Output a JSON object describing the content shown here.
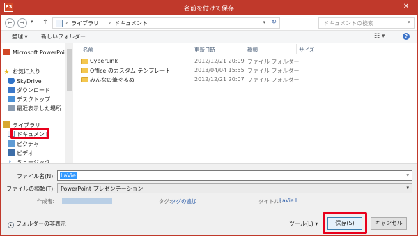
{
  "window": {
    "title": "名前を付けて保存",
    "app_icon_text": "P3",
    "close_glyph": "✕"
  },
  "nav": {
    "back_glyph": "←",
    "forward_glyph": "→",
    "up_glyph": "↑",
    "breadcrumb": [
      "ライブラリ",
      "ドキュメント"
    ],
    "search_placeholder": "ドキュメントの検索"
  },
  "toolbar": {
    "organize_label": "整理 ▾",
    "new_folder_label": "新しいフォルダー",
    "view_glyph": "☷ ▾",
    "help_glyph": "?"
  },
  "nav_pane": {
    "items": [
      {
        "label": "Microsoft PowerPoi",
        "icon": "powerpoint-icon",
        "color": "#d24726"
      },
      {
        "label": "お気に入り",
        "icon": "star-icon",
        "color": "#e8b923"
      },
      {
        "label": "SkyDrive",
        "icon": "cloud-icon",
        "color": "#2f73c9"
      },
      {
        "label": "ダウンロード",
        "icon": "download-folder-icon",
        "color": "#3b78c9"
      },
      {
        "label": "デスクトップ",
        "icon": "desktop-icon",
        "color": "#4a90d6"
      },
      {
        "label": "最近表示した場所",
        "icon": "recent-places-icon",
        "color": "#8a9bb0"
      },
      {
        "label": "ライブラリ",
        "icon": "library-icon",
        "color": "#d9a730"
      },
      {
        "label": "ドキュメント",
        "icon": "documents-icon",
        "color": "#6b8cae"
      },
      {
        "label": "ピクチャ",
        "icon": "pictures-icon",
        "color": "#5f9bd4"
      },
      {
        "label": "ビデオ",
        "icon": "videos-icon",
        "color": "#3e6ea8"
      },
      {
        "label": "ミュージック",
        "icon": "music-icon",
        "color": "#3c7fc7"
      }
    ]
  },
  "file_list": {
    "columns": [
      "名前",
      "更新日時",
      "種類",
      "サイズ"
    ],
    "rows": [
      {
        "name": "CyberLink",
        "date": "2012/12/21 20:09",
        "type": "ファイル フォルダー"
      },
      {
        "name": "Office のカスタム テンプレート",
        "date": "2013/04/04 15:55",
        "type": "ファイル フォルダー"
      },
      {
        "name": "みんなの筆ぐるめ",
        "date": "2012/12/21 20:07",
        "type": "ファイル フォルダー"
      }
    ]
  },
  "save_form": {
    "filename_label": "ファイル名(N):",
    "filename_value": "LaVie",
    "filetype_label": "ファイルの種類(T):",
    "filetype_value": "PowerPoint プレゼンテーション",
    "author_label": "作成者:",
    "tags_label": "タグ:",
    "tags_value": "タグの追加",
    "title_label": "タイトル:",
    "title_value": "LaVie L"
  },
  "footer": {
    "hide_folders_label": "フォルダーの非表示",
    "tools_label": "ツール(L) ▾",
    "save_label": "保存(S)",
    "cancel_label": "キャンセル"
  },
  "colors": {
    "titlebar": "#c0392b",
    "highlight": "#e8001c",
    "selection": "#3399ff"
  }
}
